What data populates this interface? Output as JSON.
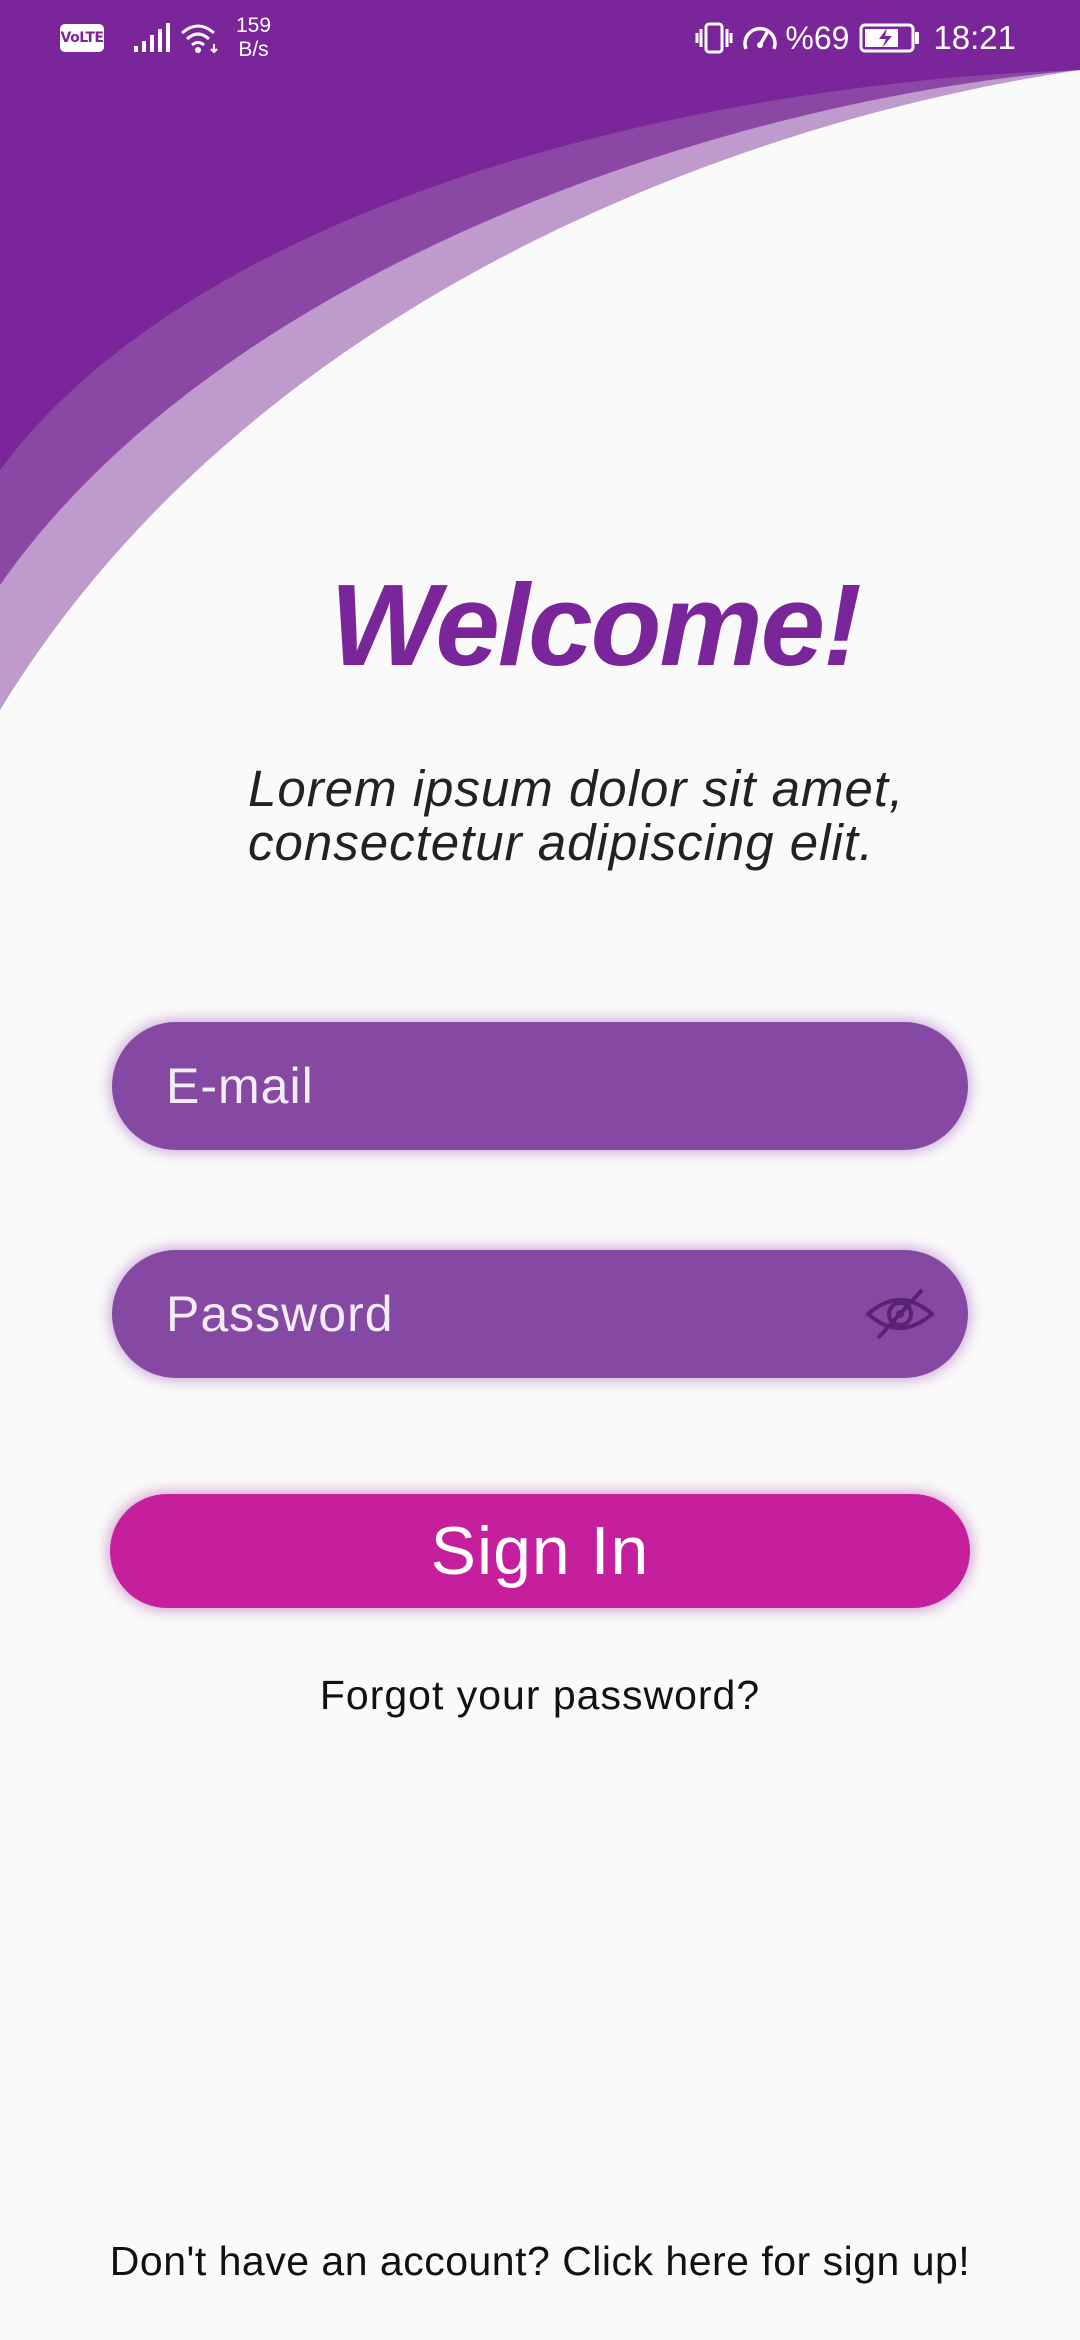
{
  "status_bar": {
    "volte": "VoLTE",
    "net_speed_value": "159",
    "net_speed_unit": "B/s",
    "battery": "%69",
    "time": "18:21",
    "icons": [
      "volte-icon",
      "signal-icon",
      "wifi-icon",
      "vibrate-icon",
      "speedometer-icon",
      "battery-charging-icon"
    ]
  },
  "login": {
    "title": "Welcome!",
    "subtitle_line1": "Lorem ipsum dolor sit amet,",
    "subtitle_line2": "consectetur adipiscing elit.",
    "email_placeholder": "E-mail",
    "password_placeholder": "Password",
    "sign_in_label": "Sign In",
    "forgot_password": "Forgot your password?",
    "sign_up_prompt": "Don't have an account? Click here for sign up!",
    "password_toggle_icon": "eye-off-icon"
  },
  "colors": {
    "primary_purple": "#7b259b",
    "field_purple": "#8649a3",
    "accent_magenta": "#c51f9e",
    "background": "#fafafa"
  }
}
